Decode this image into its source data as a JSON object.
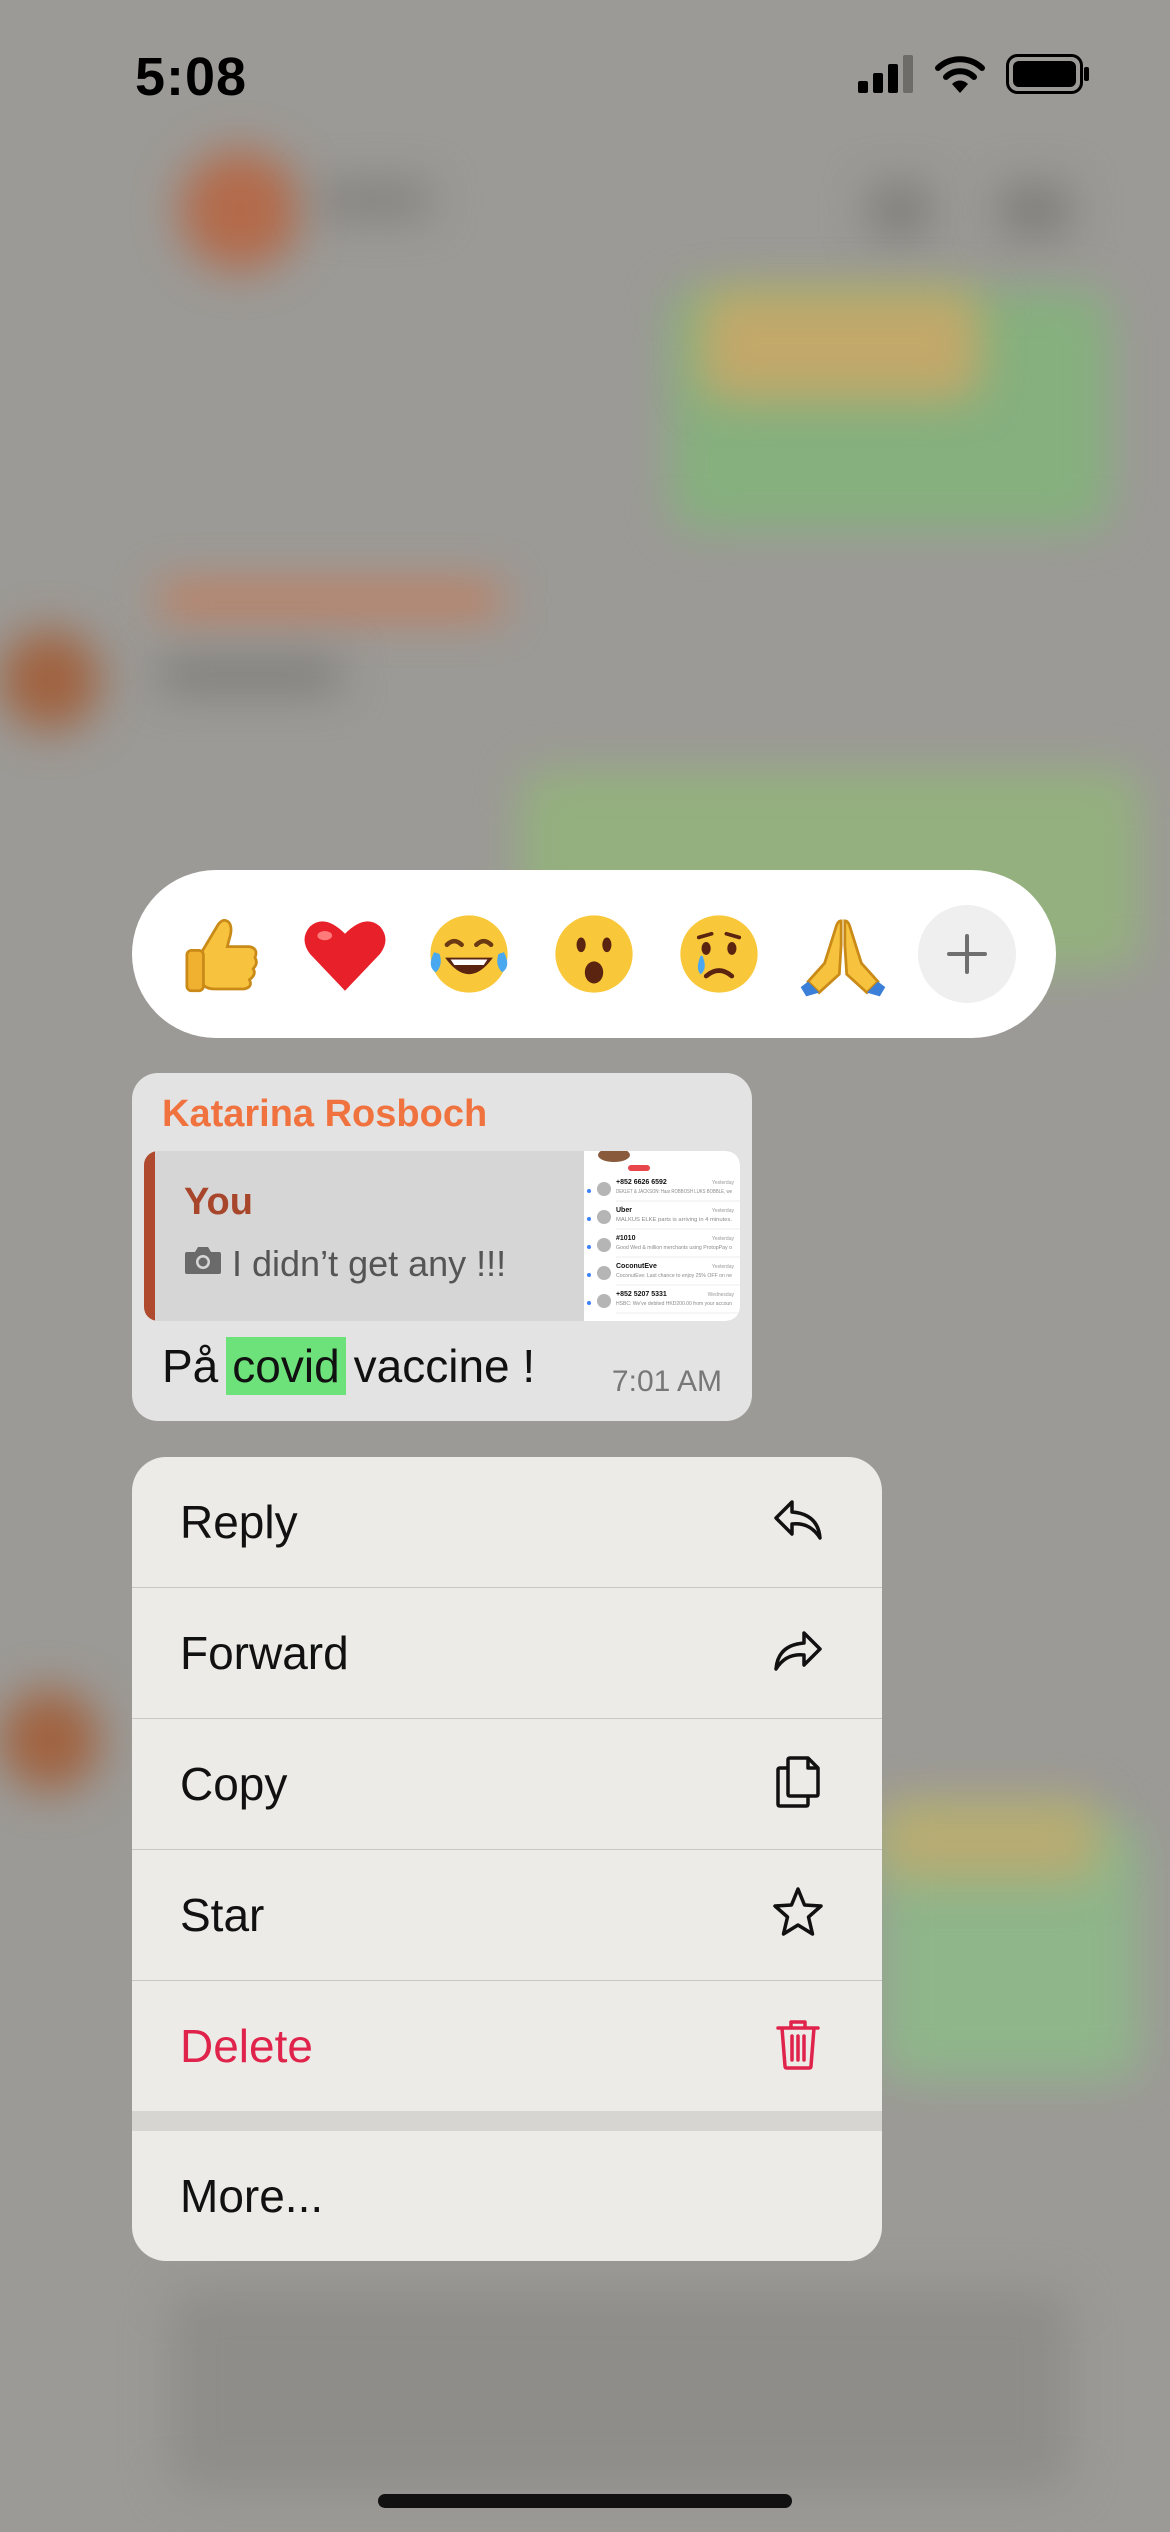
{
  "status_bar": {
    "time": "5:08"
  },
  "reactions": {
    "items": [
      {
        "name": "thumbs-up"
      },
      {
        "name": "heart"
      },
      {
        "name": "laughing"
      },
      {
        "name": "surprised"
      },
      {
        "name": "crying"
      },
      {
        "name": "praying-hands"
      }
    ],
    "more_icon": "plus-icon"
  },
  "message": {
    "sender": "Katarina Rosboch",
    "quoted": {
      "author": "You",
      "text": "I didn’t get any !!!",
      "thumbnail_rows": [
        {
          "title": "+852 6626 6592",
          "time": "Yesterday",
          "snippet": "DEKLET & JACKSON: Haar ROBBOSH LUKS BOBBLE, we would like to confirm your de..."
        },
        {
          "title": "Uber",
          "time": "Yesterday",
          "snippet": "MALKUS ELKE parts is arriving in 4 minutes."
        },
        {
          "title": "#1010",
          "time": "Yesterday",
          "snippet": "Good Wed & million merchants using ProtopPay or Vodafone best accept paymen..."
        },
        {
          "title": "CoconutEve",
          "time": "Yesterday",
          "snippet": "CoconutEve: Last chance to enjoy 25% OFF on next orders! Don't miss out, offer ends..."
        },
        {
          "title": "+852 5207 5331",
          "time": "Wednesday",
          "snippet": "HSBC: We've debited HKD200.00 from your account 847-888558-838 for 0025-15-11"
        }
      ]
    },
    "text_before": "På",
    "text_highlight": "covid",
    "text_after": "vaccine !",
    "time": "7:01 AM"
  },
  "menu": {
    "items": [
      {
        "label": "Reply",
        "icon": "reply-icon"
      },
      {
        "label": "Forward",
        "icon": "forward-icon"
      },
      {
        "label": "Copy",
        "icon": "copy-icon"
      },
      {
        "label": "Star",
        "icon": "star-icon"
      },
      {
        "label": "Delete",
        "icon": "trash-icon",
        "danger": true
      }
    ],
    "more_label": "More..."
  },
  "colors": {
    "sender": "#f0733f",
    "quote_author": "#a8462c",
    "highlight": "#6ee27a",
    "danger": "#e0234b"
  }
}
